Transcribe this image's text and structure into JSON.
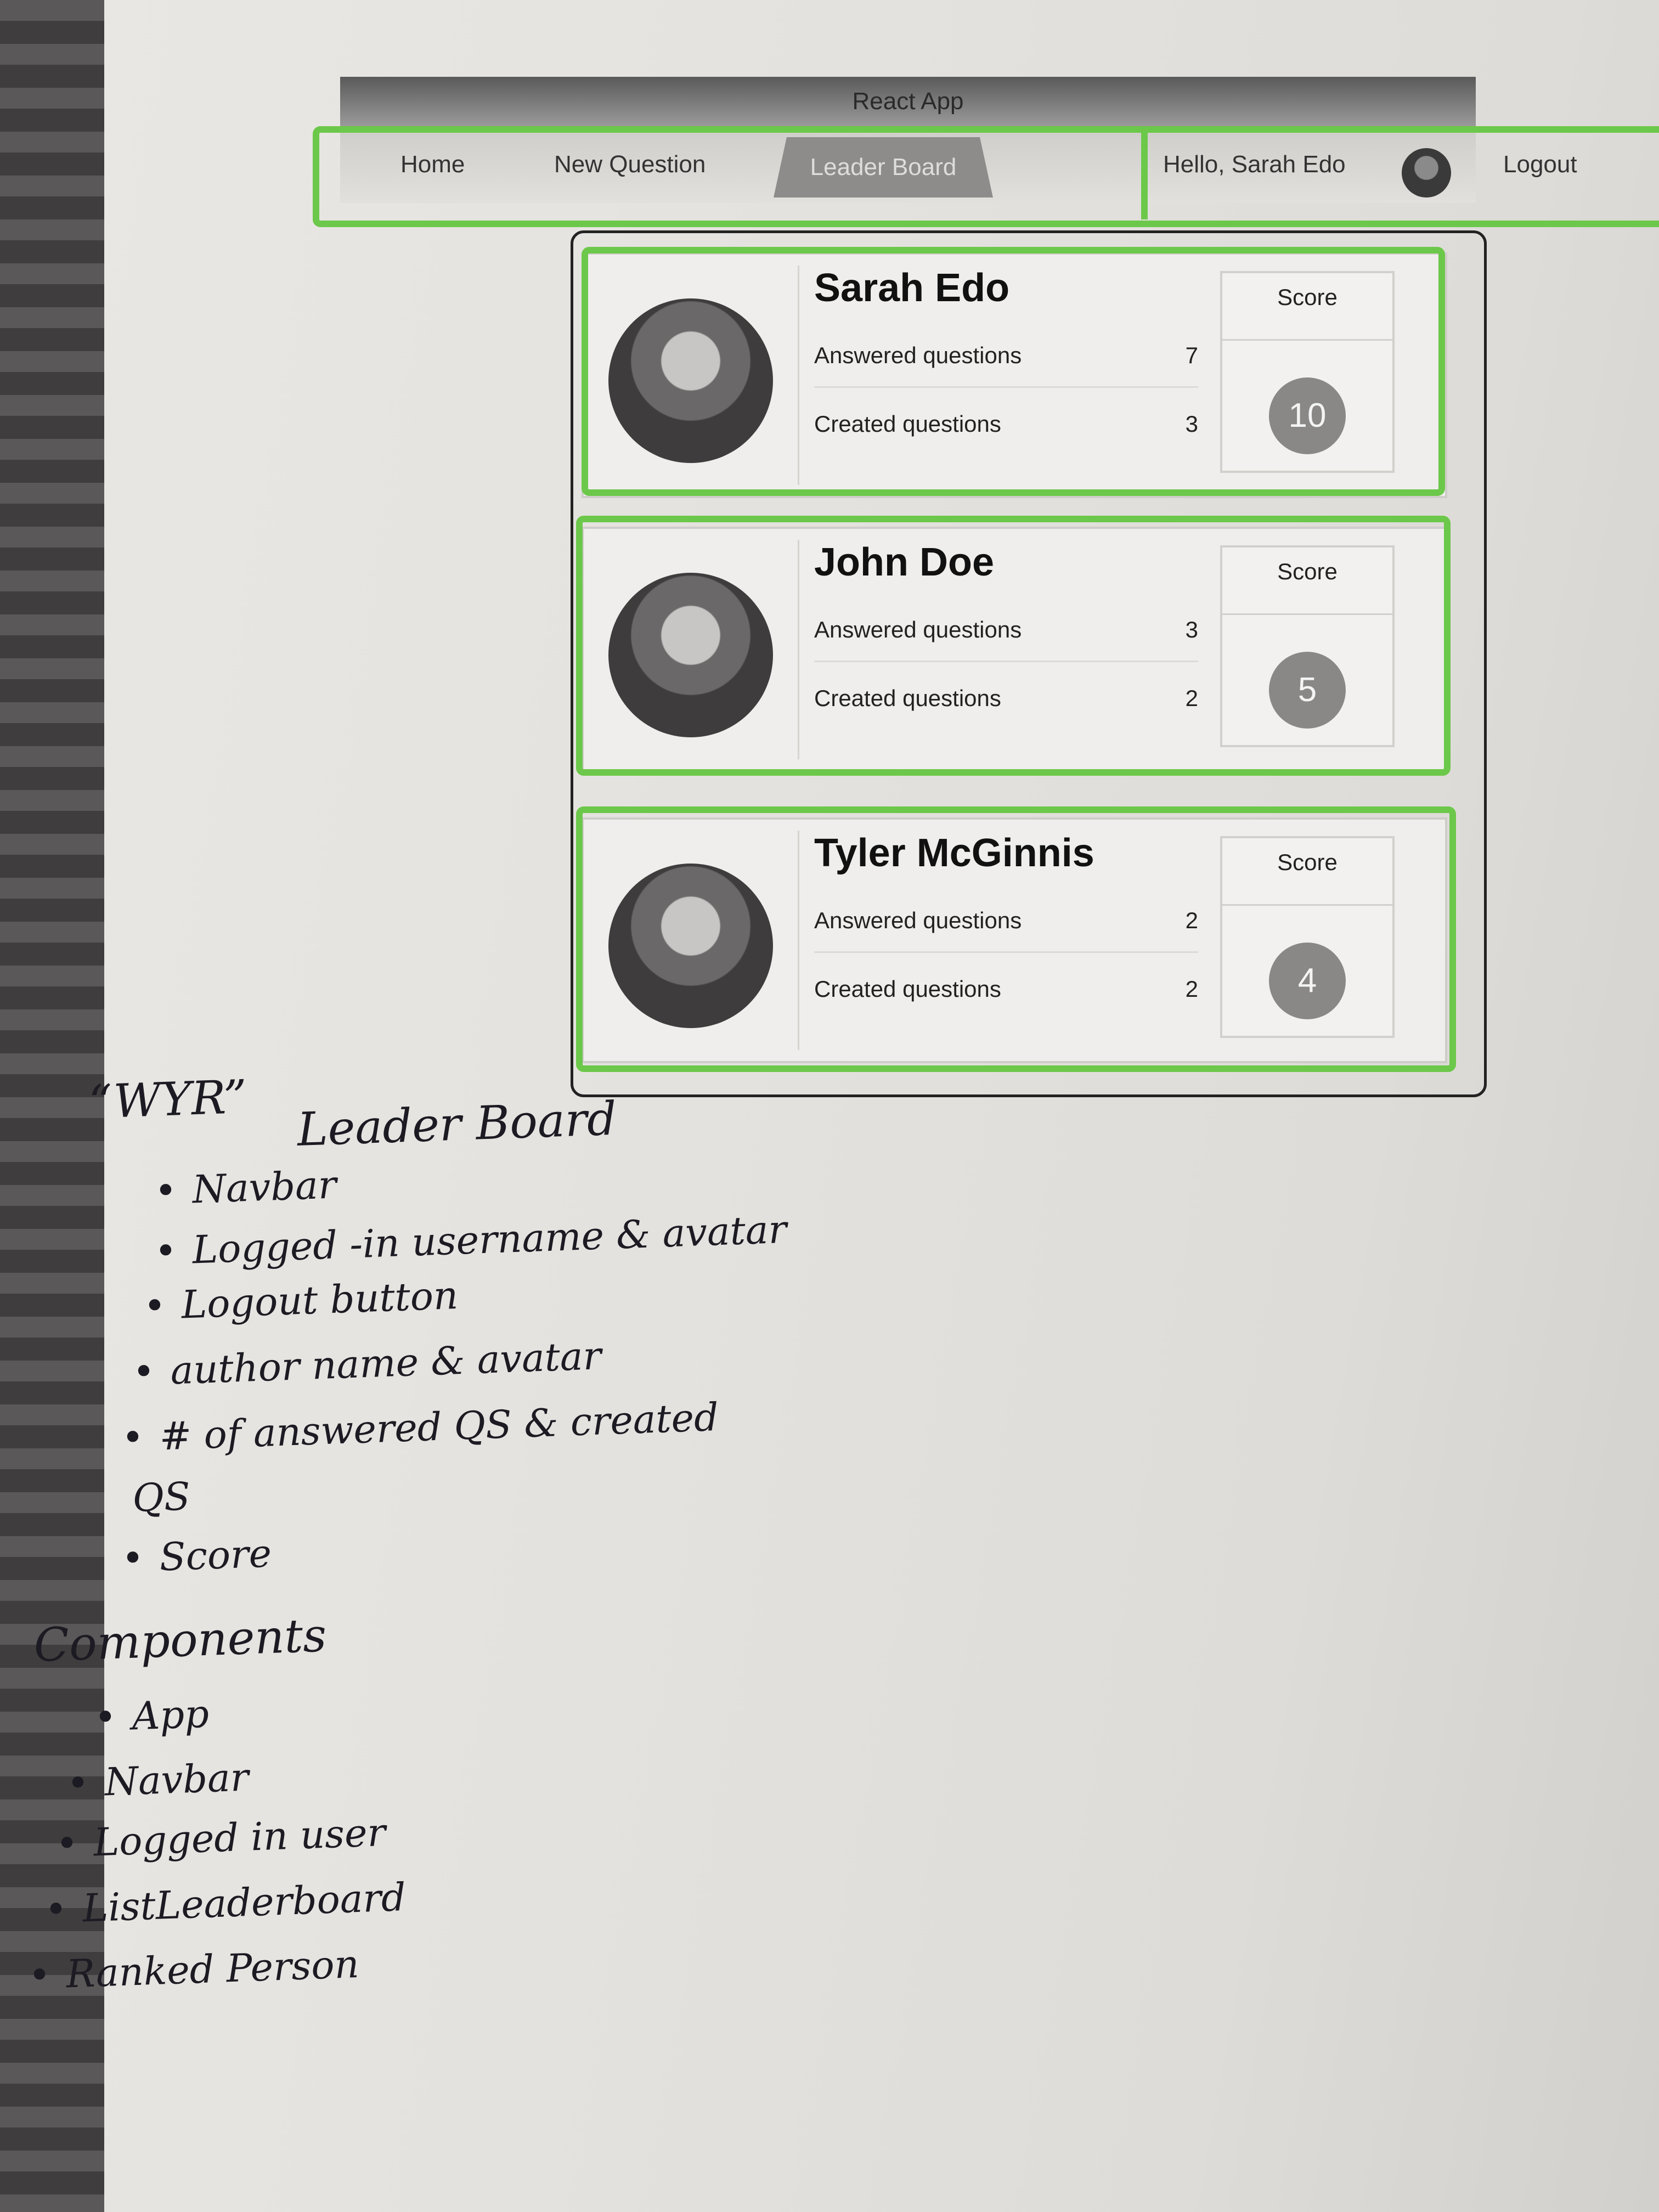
{
  "app": {
    "window_title": "React App",
    "nav": {
      "home": "Home",
      "new_question": "New Question",
      "leader_board": "Leader Board",
      "greeting": "Hello, Sarah Edo",
      "logout": "Logout",
      "active_tab": "leader_board"
    },
    "leaderboard": [
      {
        "name": "Sarah Edo",
        "answered_label": "Answered questions",
        "answered": "7",
        "created_label": "Created questions",
        "created": "3",
        "score_label": "Score",
        "score": "10"
      },
      {
        "name": "John Doe",
        "answered_label": "Answered questions",
        "answered": "3",
        "created_label": "Created questions",
        "created": "2",
        "score_label": "Score",
        "score": "5"
      },
      {
        "name": "Tyler McGinnis",
        "answered_label": "Answered questions",
        "answered": "2",
        "created_label": "Created questions",
        "created": "2",
        "score_label": "Score",
        "score": "4"
      }
    ]
  },
  "notes": {
    "title_left": "“WYR”",
    "title_right": "Leader Board",
    "features": [
      "Navbar",
      "Logged -in username & avatar",
      "Logout button",
      "author name & avatar",
      "# of answered QS & created",
      "QS",
      "Score"
    ],
    "components_heading": "Components",
    "components": [
      "App",
      "Navbar",
      "Logged in user",
      "ListLeaderboard",
      "Ranked Person"
    ]
  },
  "colors": {
    "marker_green": "#6cc84a",
    "score_circle": "#8a8886",
    "paper": "#e6e4e0"
  }
}
